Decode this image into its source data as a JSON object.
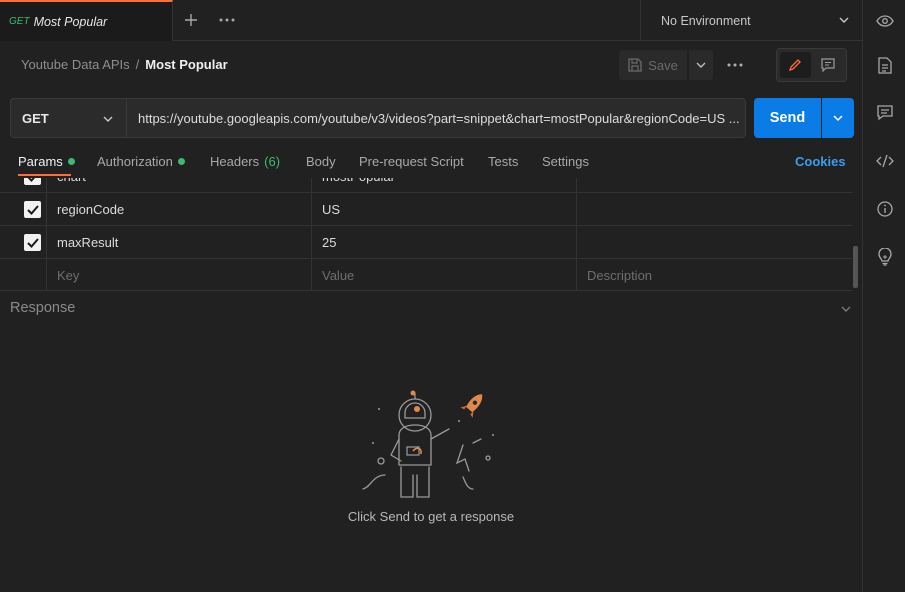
{
  "tab": {
    "method": "GET",
    "title": "Most Popular"
  },
  "environment": {
    "label": "No Environment"
  },
  "breadcrumb": {
    "parent": "Youtube Data APIs",
    "separator": "/",
    "current": "Most Popular"
  },
  "toolbar": {
    "save_label": "Save"
  },
  "request": {
    "method": "GET",
    "url": "https://youtube.googleapis.com/youtube/v3/videos?part=snippet&chart=mostPopular&regionCode=US ...",
    "send_label": "Send"
  },
  "subtabs": {
    "params": "Params",
    "authorization": "Authorization",
    "headers": "Headers",
    "headers_count": "(6)",
    "body": "Body",
    "prerequest": "Pre-request Script",
    "tests": "Tests",
    "settings": "Settings",
    "cookies": "Cookies"
  },
  "params": {
    "rows": [
      {
        "key": "chart",
        "value": "mostPopular",
        "checked": true
      },
      {
        "key": "regionCode",
        "value": "US",
        "checked": true
      },
      {
        "key": "maxResult",
        "value": "25",
        "checked": true
      }
    ],
    "placeholders": {
      "key": "Key",
      "value": "Value",
      "description": "Description"
    }
  },
  "response": {
    "title": "Response",
    "empty_message": "Click Send to get a response"
  },
  "colors": {
    "accent": "#ff6c37",
    "send": "#0b7ce6",
    "green": "#3dba6f",
    "link": "#3a9df0"
  }
}
